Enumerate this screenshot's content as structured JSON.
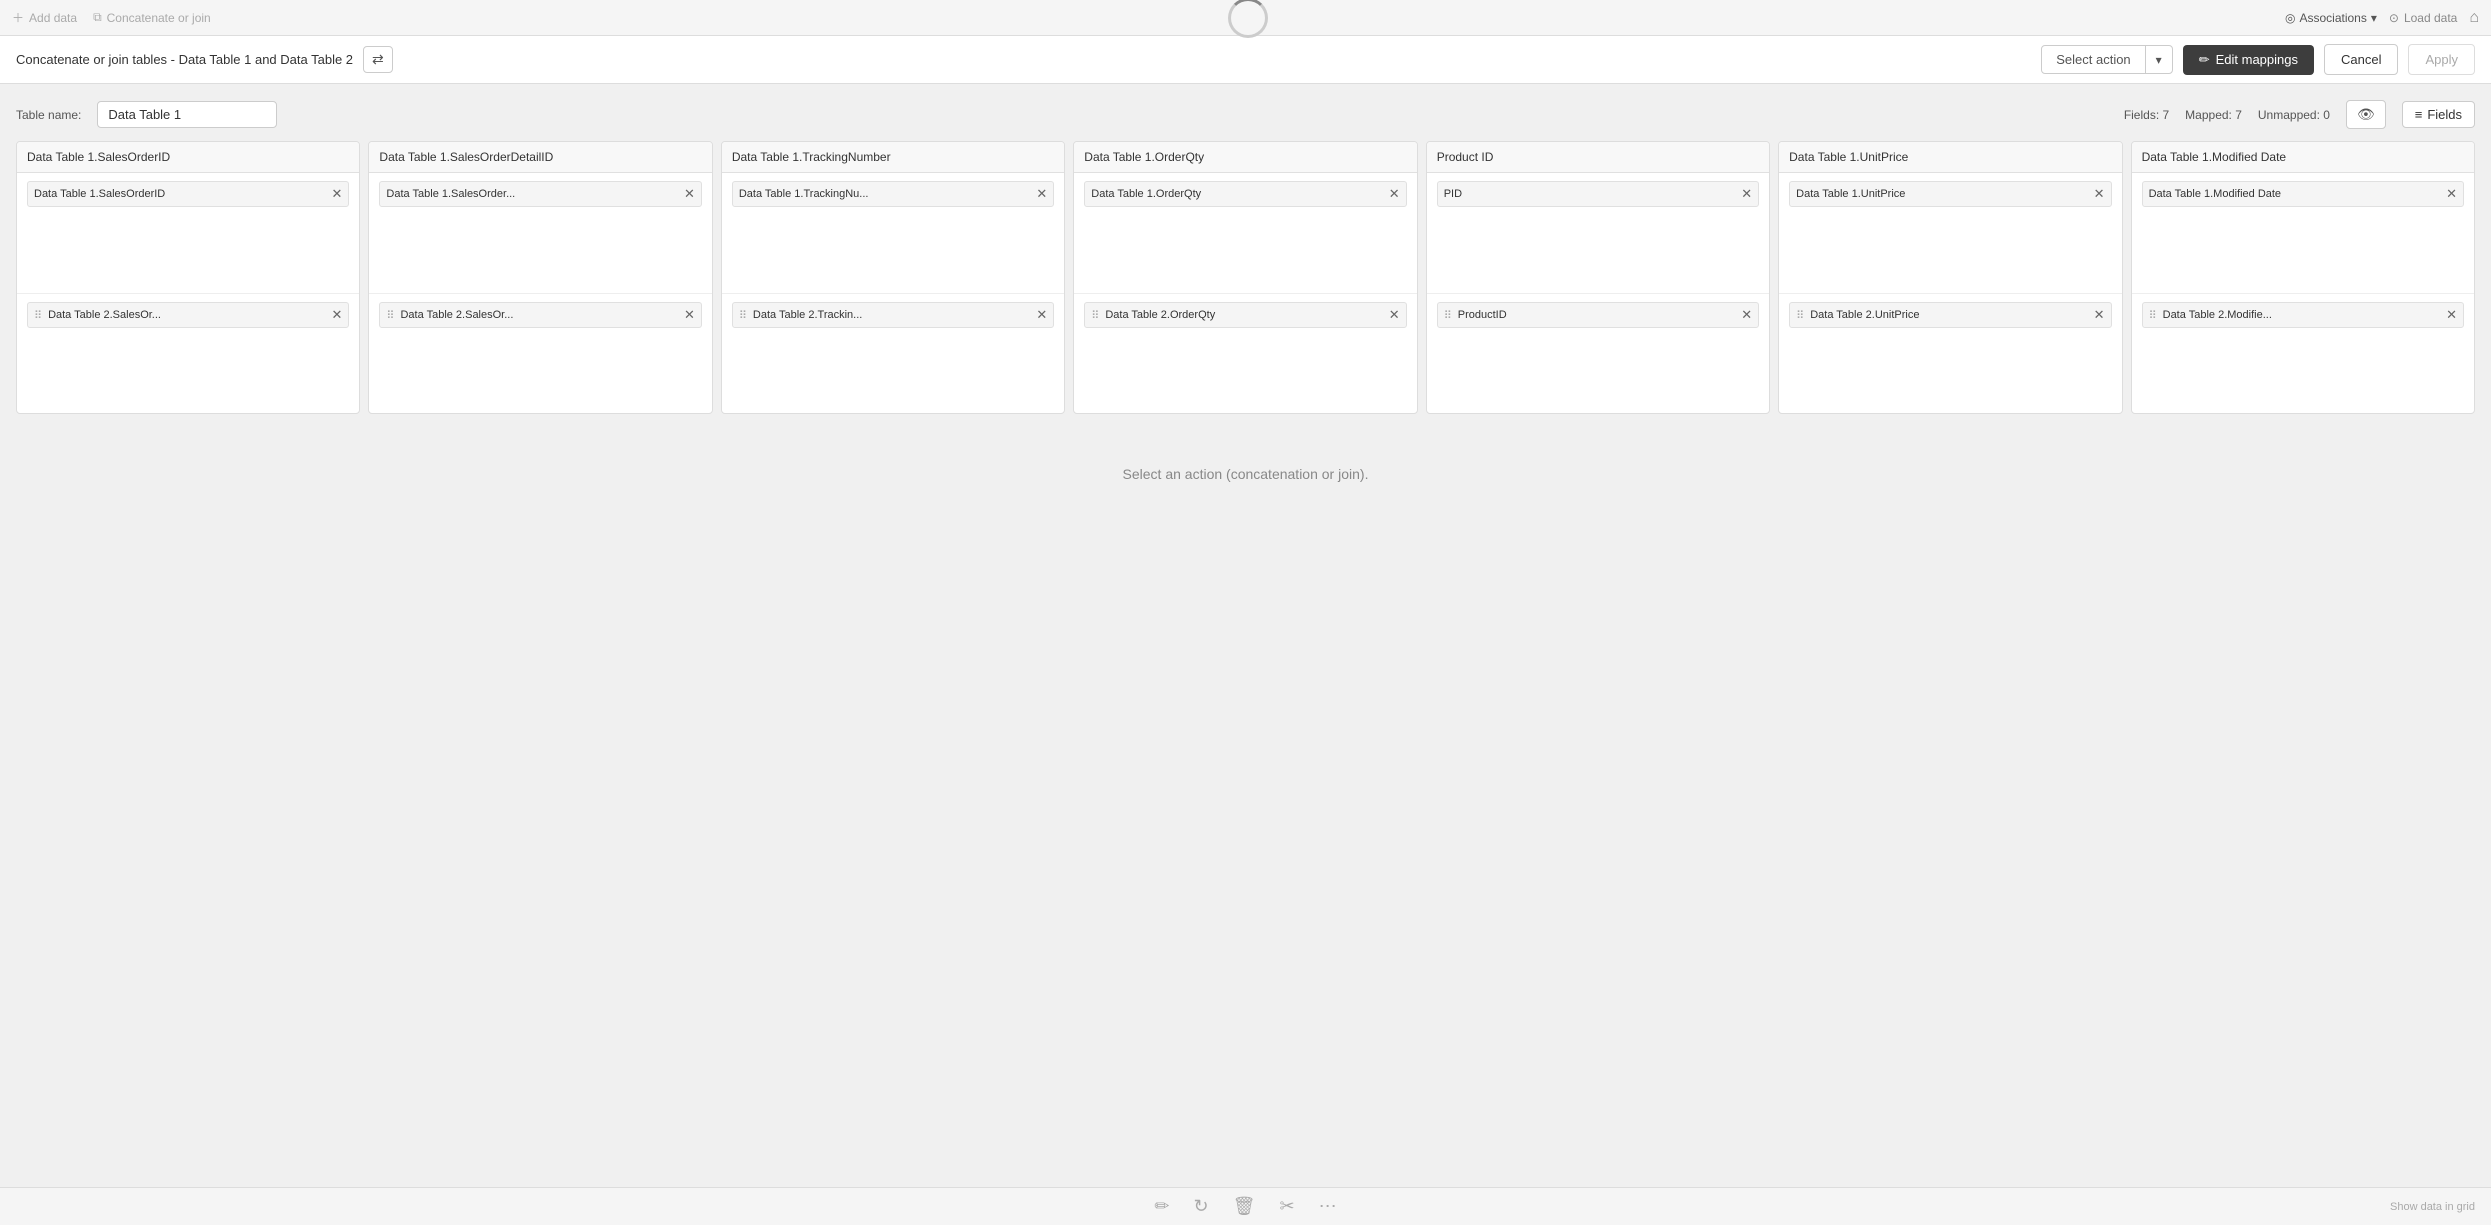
{
  "topNav": {
    "addData": "Add data",
    "concatenateOrJoin": "Concatenate or join",
    "associations": "Associations",
    "loadData": "Load data"
  },
  "toolbar": {
    "title": "Concatenate or join tables - Data Table 1 and Data Table 2",
    "selectAction": "Select action",
    "editMappings": "Edit mappings",
    "cancel": "Cancel",
    "apply": "Apply"
  },
  "tableName": {
    "label": "Table name:",
    "value": "Data Table 1"
  },
  "fieldsInfo": {
    "fields": "Fields: 7",
    "mapped": "Mapped: 7",
    "unmapped": "Unmapped: 0",
    "fieldsBtn": "Fields"
  },
  "columns": [
    {
      "header": "Data Table 1.SalesOrderID",
      "sourceRow": "Data Table 1.SalesOrderID",
      "destRow": "Data Table 2.SalesOr..."
    },
    {
      "header": "Data Table 1.SalesOrderDetailID",
      "sourceRow": "Data Table 1.SalesOrder...",
      "destRow": "Data Table 2.SalesOr..."
    },
    {
      "header": "Data Table 1.TrackingNumber",
      "sourceRow": "Data Table 1.TrackingNu...",
      "destRow": "Data Table 2.Trackin..."
    },
    {
      "header": "Data Table 1.OrderQty",
      "sourceRow": "Data Table 1.OrderQty",
      "destRow": "Data Table 2.OrderQty"
    },
    {
      "header": "Product ID",
      "sourceRow": "PID",
      "destRow": "ProductID"
    },
    {
      "header": "Data Table 1.UnitPrice",
      "sourceRow": "Data Table 1.UnitPrice",
      "destRow": "Data Table 2.UnitPrice"
    },
    {
      "header": "Data Table 1.Modified Date",
      "sourceRow": "Data Table 1.Modified Date",
      "destRow": "Data Table 2.Modifie..."
    }
  ],
  "bottomMessage": "Select an action (concatenation or join).",
  "bottomTools": [
    "pencil",
    "refresh",
    "trash",
    "cut",
    "dots"
  ]
}
